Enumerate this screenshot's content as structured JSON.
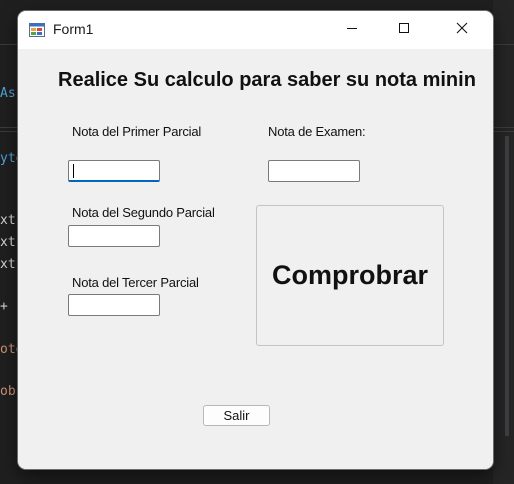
{
  "window": {
    "title": "Form1",
    "icons": {
      "app": "winform-app-icon",
      "minimize": "minimize-icon",
      "maximize": "maximize-icon",
      "close": "close-icon"
    }
  },
  "form": {
    "heading": "Realice Su calculo para saber su nota minin",
    "fields": {
      "primer_parcial": {
        "label": "Nota del Primer Parcial",
        "value": ""
      },
      "segundo_parcial": {
        "label": "Nota del Segundo Parcial",
        "value": ""
      },
      "tercer_parcial": {
        "label": "Nota del Tercer Parcial",
        "value": ""
      },
      "examen": {
        "label": "Nota de Examen:",
        "value": ""
      }
    },
    "buttons": {
      "comprobar": "Comprobrar",
      "salir": "Salir"
    }
  },
  "background_editor": {
    "fragments": [
      "As",
      "yte",
      "xt",
      "xt",
      "xt",
      "+",
      "ote",
      "ob"
    ]
  },
  "colors": {
    "focus_accent": "#0067c0",
    "window_bg": "#f0f0f0",
    "titlebar_bg": "#ffffff",
    "ide_bg": "#1f1f1f"
  }
}
